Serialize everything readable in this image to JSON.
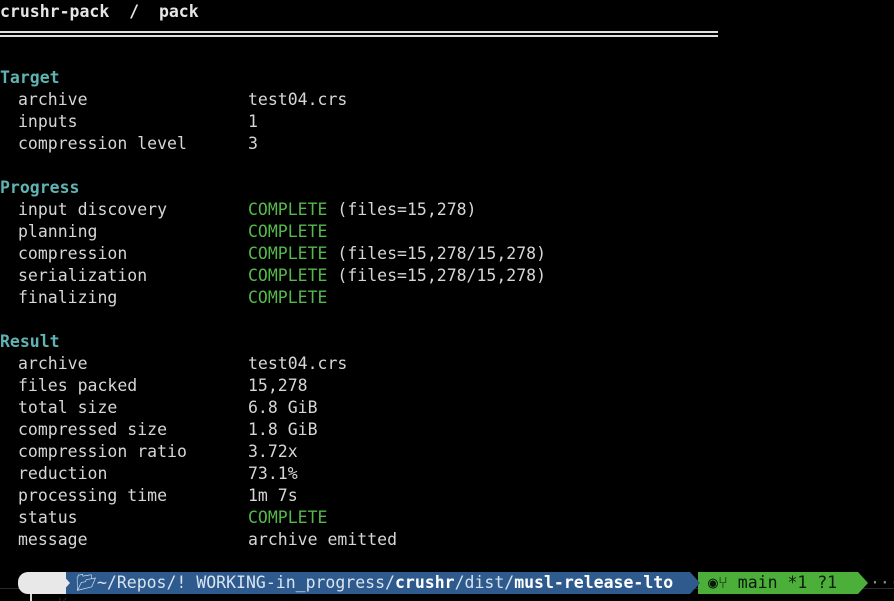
{
  "header": {
    "title": "crushr-pack  /  pack"
  },
  "target": {
    "heading": "Target",
    "rows": [
      {
        "key": "archive",
        "value": "test04.crs"
      },
      {
        "key": "inputs",
        "value": "1"
      },
      {
        "key": "compression level",
        "value": "3"
      }
    ]
  },
  "progress": {
    "heading": "Progress",
    "rows": [
      {
        "key": "input discovery",
        "status": "COMPLETE",
        "detail": " (files=15,278)"
      },
      {
        "key": "planning",
        "status": "COMPLETE",
        "detail": ""
      },
      {
        "key": "compression",
        "status": "COMPLETE",
        "detail": " (files=15,278/15,278)"
      },
      {
        "key": "serialization",
        "status": "COMPLETE",
        "detail": " (files=15,278/15,278)"
      },
      {
        "key": "finalizing",
        "status": "COMPLETE",
        "detail": ""
      }
    ]
  },
  "result": {
    "heading": "Result",
    "rows": [
      {
        "key": "archive",
        "value": "test04.crs"
      },
      {
        "key": "files packed",
        "value": "15,278"
      },
      {
        "key": "total size",
        "value": "6.8 GiB"
      },
      {
        "key": "compressed size",
        "value": "1.8 GiB"
      },
      {
        "key": "compression ratio",
        "value": "3.72x"
      },
      {
        "key": "reduction",
        "value": "73.1%"
      },
      {
        "key": "processing time",
        "value": "1m 7s"
      },
      {
        "key": "status",
        "value": "COMPLETE"
      },
      {
        "key": "message",
        "value": "archive emitted"
      }
    ]
  },
  "prompt": {
    "os_icon": "kde-icon",
    "os_glyph": "K",
    "dir_icon": "folder-icon",
    "dir_prefix": "~/Repos/! WORKING-in_progress/",
    "dir_repo": "crushr",
    "dir_mid": "/dist/",
    "dir_leaf": "musl-release-lto",
    "git_icon": "github-icon",
    "branch_icon": "branch-icon",
    "branch": "main *1 ?1",
    "trail": "·····"
  },
  "colors": {
    "background": "#000000",
    "section": "#5fb3b3",
    "complete": "#55b84a",
    "dir_segment": "#2e5a8e",
    "git_segment": "#4caf3a",
    "os_segment": "#e8e8e8"
  }
}
